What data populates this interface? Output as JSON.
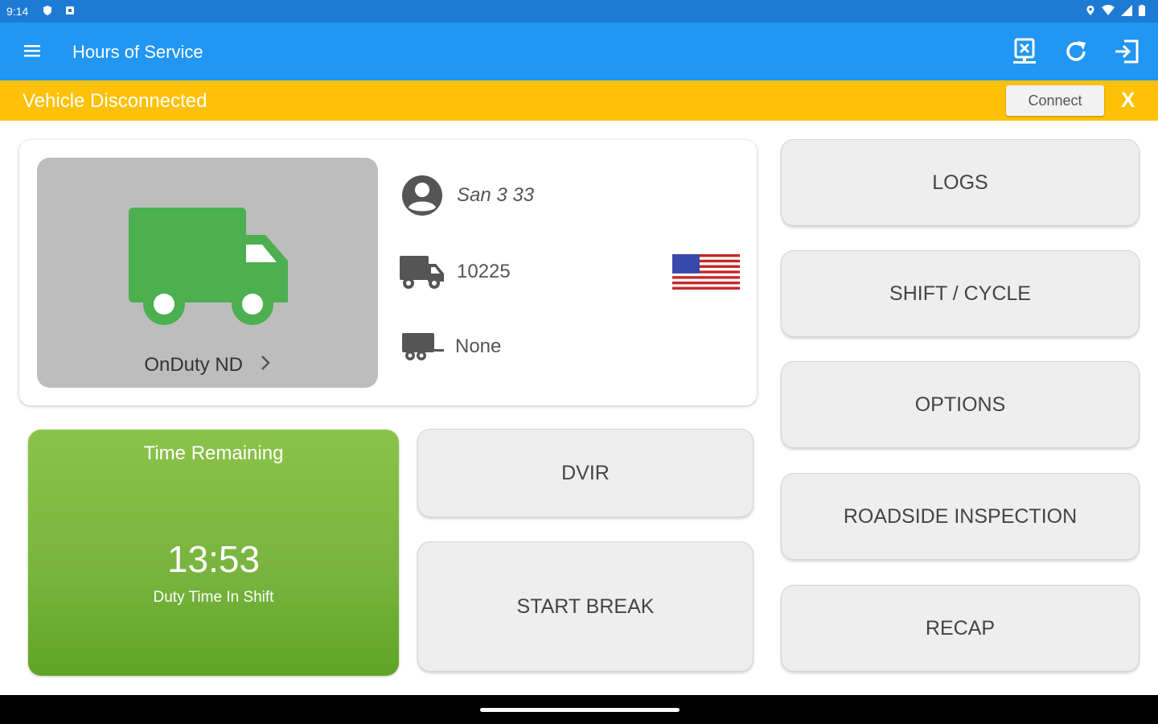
{
  "status_bar": {
    "time": "9:14"
  },
  "app_bar": {
    "title": "Hours of Service",
    "actions": [
      "transfer-icon",
      "refresh-icon",
      "logout-icon"
    ]
  },
  "banner": {
    "message": "Vehicle Disconnected",
    "connect_label": "Connect",
    "close_label": "X"
  },
  "driver_status": {
    "label": "OnDuty ND"
  },
  "info": {
    "driver_name": "San 3 33",
    "vehicle": "10225",
    "trailer": "None"
  },
  "time_remaining": {
    "title": "Time Remaining",
    "value": "13:53",
    "subtitle": "Duty Time In Shift"
  },
  "buttons": {
    "dvir": "DVIR",
    "start_break": "START BREAK",
    "logs": "LOGS",
    "shift_cycle": "SHIFT / CYCLE",
    "options": "OPTIONS",
    "roadside": "ROADSIDE INSPECTION",
    "recap": "RECAP"
  },
  "colors": {
    "status_bar": "#1e7bd4",
    "app_bar": "#2196f3",
    "banner": "#ffc107",
    "truck_green": "#4caf50",
    "time_green": "#8bc34a"
  }
}
